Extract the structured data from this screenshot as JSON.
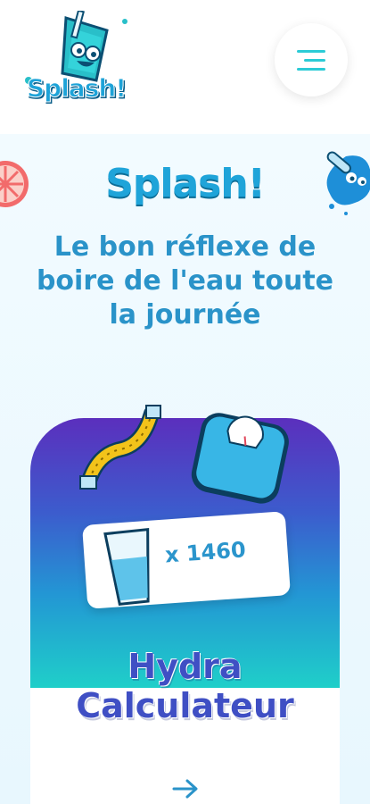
{
  "header": {
    "logo_text": "Splash!",
    "menu_icon": "menu-icon"
  },
  "hero": {
    "brand": "Splash!",
    "tagline": "Le bon réflexe de boire de l'eau toute la journée"
  },
  "card": {
    "glass_count": "x 1460",
    "title": "Hydra Calculateur",
    "arrow_icon": "arrow-right-icon"
  },
  "colors": {
    "brand_blue": "#1fa4d9",
    "accent_cyan": "#2ccbd6",
    "purple": "#5b2fbd"
  }
}
